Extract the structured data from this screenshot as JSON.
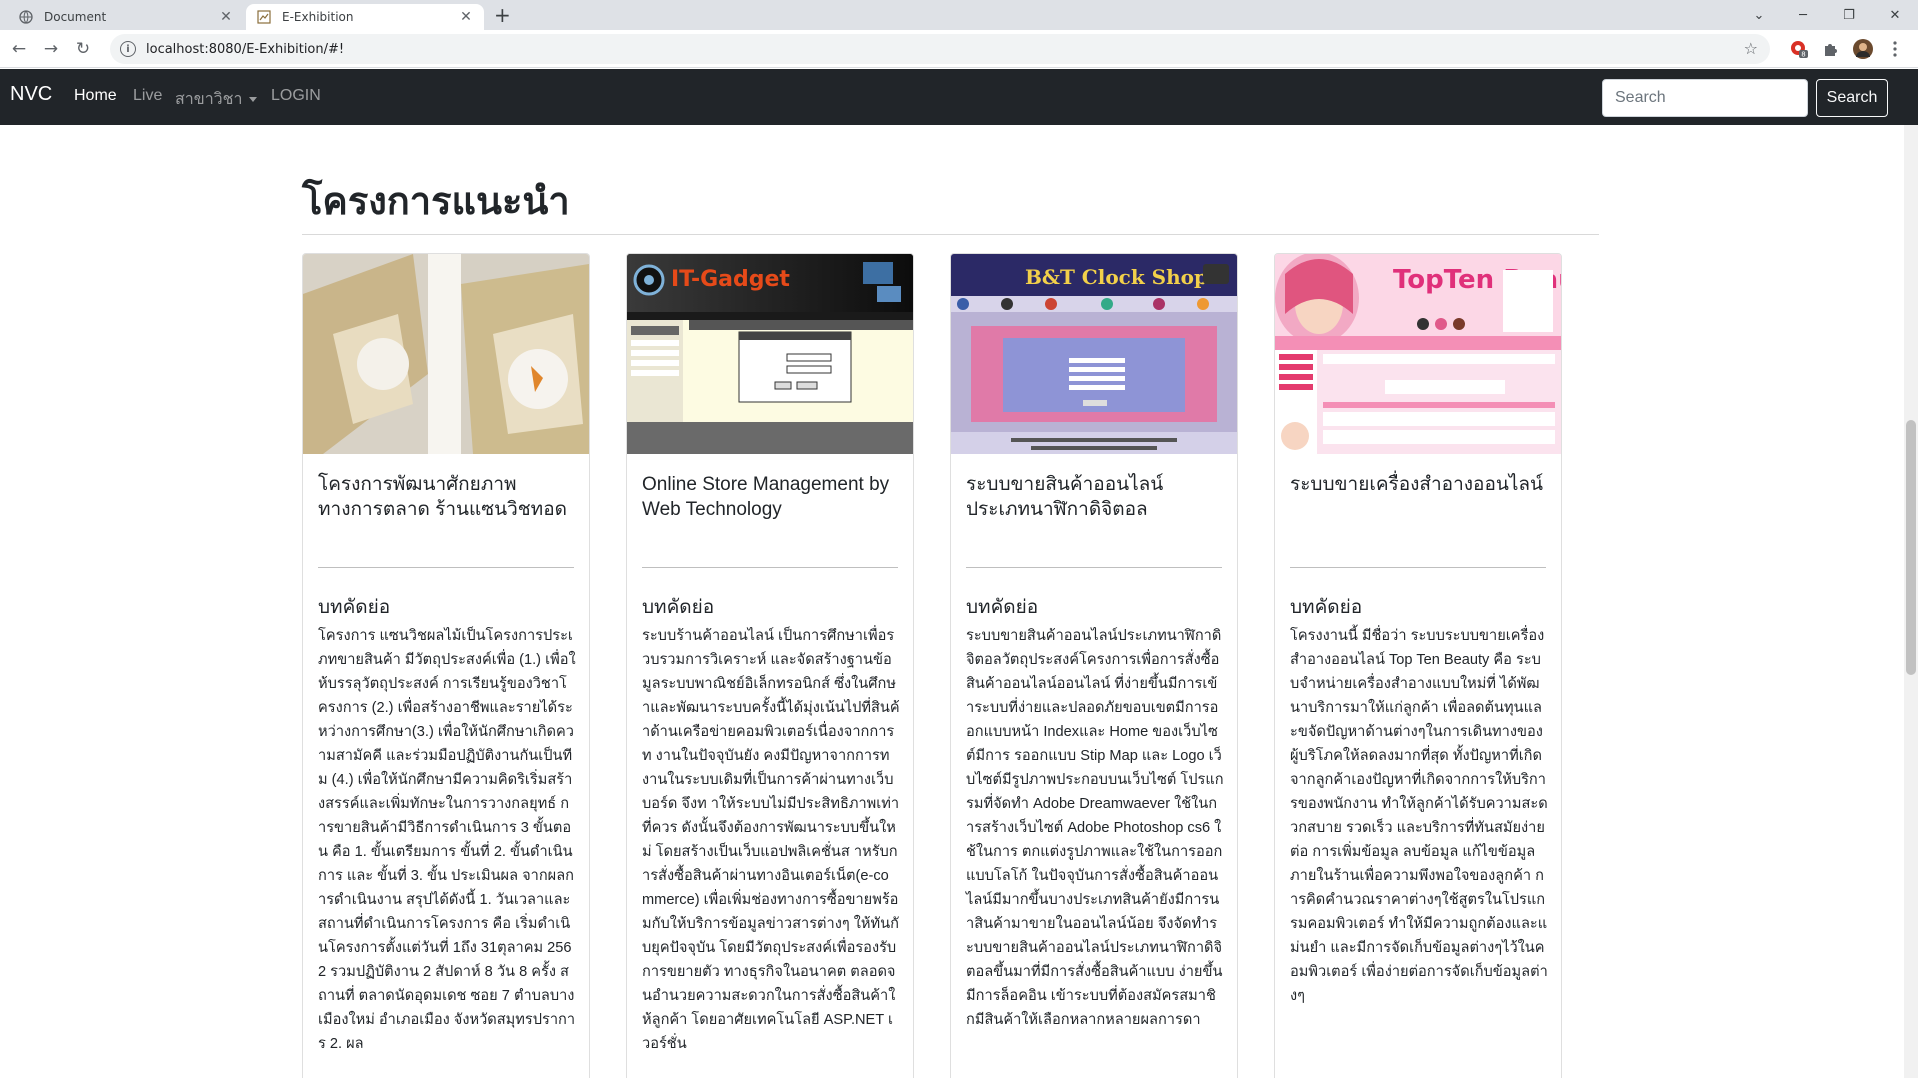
{
  "browser": {
    "tabs": [
      {
        "title": "Document",
        "active": false
      },
      {
        "title": "E-Exhibition",
        "active": true
      }
    ],
    "url": "localhost:8080/E-Exhibition/#!"
  },
  "navbar": {
    "brand": "NVC",
    "links": [
      {
        "label": "Home",
        "active": true
      },
      {
        "label": "Live",
        "active": false
      },
      {
        "label": "สาขาวิชา",
        "active": false,
        "dropdown": true
      },
      {
        "label": "LOGIN",
        "active": false
      }
    ],
    "search_placeholder": "Search",
    "search_button": "Search"
  },
  "section": {
    "title": "โครงการแนะนำ"
  },
  "cards": [
    {
      "image_text": "",
      "title": "โครงการพัฒนาศักยภาพทางการตลาด ร้านแซนวิชทอด",
      "subtitle": "บทคัดย่อ",
      "abstract": "โครงการ แซนวิชผลไม้เป็นโครงการประเภทขายสินค้า มีวัตถุประสงค์เพื่อ (1.) เพื่อให้บรรลุวัตถุประสงค์ การเรียนรู้ของวิชาโครงการ (2.) เพื่อสร้างอาชีพและรายได้ระหว่างการศึกษา(3.) เพื่อให้นักศึกษาเกิดความสามัคคี และร่วมมือปฏิบัติงานกันเป็นทีม (4.) เพื่อให้นักศึกษามีความคิดริเริ่มสร้างสรรค์และเพิ่มทักษะในการวางกลยุทธ์ การขายสินค้ามีวิธีการดำเนินการ 3 ขั้นตอน คือ 1. ขั้นเตรียมการ ขั้นที่ 2. ขั้นดำเนินการ และ ขั้นที่ 3. ขั้น ประเมินผล จากผลการดำเนินงาน สรุปได้ดังนี้ 1. วันเวลาและสถานที่ดำเนินการโครงการ คือ เริ่มดำเนินโครงการตั้งแต่วันที่ 1ถึง 31ตุลาคม 2562 รวมปฏิบัติงาน 2 สัปดาห์ 8 วัน 8 ครั้ง สถานที่ ตลาดนัดอุดมเดช ซอย 7 ตำบลบางเมืองใหม่ อำเภอเมือง จังหวัดสมุทรปราการ 2. ผล"
    },
    {
      "image_text": "IT-Gadget",
      "title": "Online Store Management by Web Technology",
      "subtitle": "บทคัดย่อ",
      "abstract": "ระบบร้านค้าออนไลน์ เป็นการศึกษาเพื่อรวบรวมการวิเคราะห์ และจัดสร้างฐานข้อมูลระบบพาณิชย์อิเล็กทรอนิกส์ ซึ่งในศึกษาและพัฒนาระบบครั้งนี้ได้มุ่งเน้นไปที่สินค้าด้านเครือข่ายคอมพิวเตอร์เนื่องจากการท งานในปัจจุบันยัง คงมีปัญหาจากการท งานในระบบเดิมที่เป็นการค้าผ่านทางเว็บบอร์ด จึงท าให้ระบบไม่มีประสิทธิภาพเท่าที่ควร ดังนั้นจึงต้องการพัฒนาระบบขึ้นใหม่ โดยสร้างเป็นเว็บแอปพลิเคชั่นส าหรับการสั่งซื้อสินค้าผ่านทางอินเตอร์เน็ต(e-commerce) เพื่อเพิ่มช่องทางการซื้อขายพร้อมกับให้บริการข้อมูลข่าวสารต่างๆ ให้ทันกับยุคปัจจุบัน โดยมีวัตถุประสงค์เพื่อรองรับการขยายตัว ทางธุรกิจในอนาคต ตลอดจนอำนวยความสะดวกในการสั่งซื้อสินค้าให้ลูกค้า โดยอาศัยเทคโนโลยี ASP.NET เวอร์ชั่น"
    },
    {
      "image_text": "B&T Clock Shop",
      "title": "ระบบขายสินค้าออนไลน์ ประเภทนาฬิกาดิจิตอล",
      "subtitle": "บทคัดย่อ",
      "abstract": "ระบบขายสินค้าออนไลน์ประเภทนาฬิกาดิจิตอลวัตถุประสงค์โครงการเพื่อการสั่งซื้อสินค้าออนไลน์ออนไลน์ ที่ง่ายขึ้นมีการเข้าระบบที่ง่ายและปลอดภัยขอบเขตมีการออกแบบหน้า Indexและ Home ของเว็บไซต์มีการ รออกแบบ Stip Map และ Logo เว็บไซต์มีรูปภาพประกอบบนเว็บไซต์ โปรแกรมที่จัดทำ Adobe Dreamwaever ใช้ในการสร้างเว็บไซต์ Adobe Photoshop cs6 ใช้ในการ ตกแต่งรูปภาพและใช้ในการออกแบบโลโก้ ในปัจจุบันการสั่งซื้อสินค้าออนไลน์มีมากขึ้นบางประเภทสินค้ายังมีการน าสินค้ามาขายในออนไลน์น้อย จึงจัดทำระบบขายสินค้าออนไลน์ประเภทนาฬิกาดิจิตอลขึ้นมาที่มีการสั่งซื้อสินค้าแบบ ง่ายขึ้นมีการล็อคอิน เข้าระบบที่ต้องสมัครสมาชิกมีสินค้าให้เลือกหลากหลายผลการดา"
    },
    {
      "image_text": "TopTen Beauty",
      "title": "ระบบขายเครื่องสำอางออนไลน์",
      "subtitle": "บทคัดย่อ",
      "abstract": "โครงงานนี้ มีชื่อว่า ระบบระบบขายเครื่องสำอางออนไลน์ Top Ten Beauty คือ ระบบจำหน่ายเครื่องสำอางแบบใหม่ที่ ได้พัฒนาบริการมาให้แก่ลูกค้า เพื่อลดต้นทุนและขจัดปัญหาด้านต่างๆในการเดินทางของผู้บริโภคให้ลดลงมากที่สุด ทั้งปัญหาที่เกิด จากลูกค้าเองปัญหาที่เกิดจากการให้บริการของพนักงาน ทำให้ลูกค้าได้รับความสะดวกสบาย รวดเร็ว และบริการที่ทันสมัยง่ายต่อ การเพิ่มข้อมูล ลบข้อมูล แก้ไขข้อมูล ภายในร้านเพื่อความพึงพอใจของลูกค้า การคิดคำนวณราคาต่างๆใช้สูตรในโปรแกรมคอมพิวเตอร์ ทำให้มีความถูกต้องและแม่นยำ และมีการจัดเก็บข้อมูลต่างๆไว้ในคอมพิวเตอร์ เพื่อง่ายต่อการจัดเก็บข้อมูลต่างๆ"
    }
  ]
}
